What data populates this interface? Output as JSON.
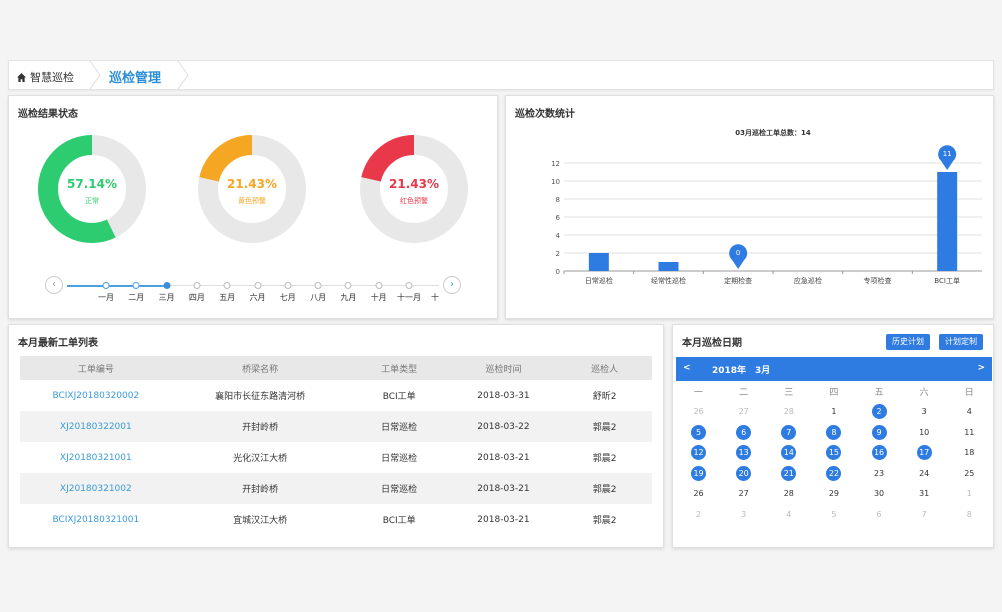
{
  "breadcrumb": {
    "home": "智慧巡检",
    "current": "巡检管理"
  },
  "status_panel": {
    "title": "巡检结果状态",
    "donuts": [
      {
        "percent": "57.14%",
        "label": "正常",
        "value": 0.5714,
        "color": "#2ecc71"
      },
      {
        "percent": "21.43%",
        "label": "黄色预警",
        "value": 0.2143,
        "color": "#f5a623"
      },
      {
        "percent": "21.43%",
        "label": "红色预警",
        "value": 0.2143,
        "color": "#e8384a"
      }
    ],
    "months": [
      "一月",
      "二月",
      "三月",
      "四月",
      "五月",
      "六月",
      "七月",
      "八月",
      "九月",
      "十月",
      "十一月",
      "十"
    ],
    "current_month_index": 2
  },
  "count_panel": {
    "title": "巡检次数统计",
    "chart_data": {
      "type": "bar",
      "title": "03月巡检工单总数：14",
      "categories": [
        "日常巡检",
        "经常性巡检",
        "定期检查",
        "应急巡检",
        "专项检查",
        "BCI工单"
      ],
      "values": [
        2,
        1,
        0,
        0,
        0,
        11
      ],
      "y_ticks": [
        "0",
        "2",
        "4",
        "6",
        "8",
        "10",
        "12"
      ],
      "ylim": [
        0,
        12
      ],
      "pin_labels": [
        {
          "index": 2,
          "text": "0"
        },
        {
          "index": 5,
          "text": "11"
        }
      ],
      "bar_color": "#2e7be2",
      "grid": true
    }
  },
  "workorder_panel": {
    "title": "本月最新工单列表",
    "columns": [
      "工单编号",
      "桥梁名称",
      "工单类型",
      "巡检时间",
      "巡检人"
    ],
    "rows": [
      [
        "BCIXJ20180320002",
        "襄阳市长征东路清河桥",
        "BCI工单",
        "2018-03-31",
        "舒昕2"
      ],
      [
        "XJ20180322001",
        "开封岭桥",
        "日常巡检",
        "2018-03-22",
        "郭晨2"
      ],
      [
        "XJ20180321001",
        "光化汉江大桥",
        "日常巡检",
        "2018-03-21",
        "郭晨2"
      ],
      [
        "XJ20180321002",
        "开封岭桥",
        "日常巡检",
        "2018-03-21",
        "郭晨2"
      ],
      [
        "BCIXJ20180321001",
        "宜城汉江大桥",
        "BCI工单",
        "2018-03-21",
        "郭晨2"
      ]
    ]
  },
  "calendar_panel": {
    "title": "本月巡检日期",
    "history_button": "历史计划",
    "plan_button": "计划定制",
    "year_label": "2018年",
    "month_label": "3月",
    "prev": "<",
    "next": ">",
    "weekdays": [
      "一",
      "二",
      "三",
      "四",
      "五",
      "六",
      "日"
    ],
    "weeks": [
      [
        {
          "d": "26",
          "dim": true
        },
        {
          "d": "27",
          "dim": true
        },
        {
          "d": "28",
          "dim": true
        },
        {
          "d": "1"
        },
        {
          "d": "2",
          "mark": true
        },
        {
          "d": "3"
        },
        {
          "d": "4"
        }
      ],
      [
        {
          "d": "5",
          "mark": true
        },
        {
          "d": "6",
          "mark": true
        },
        {
          "d": "7",
          "mark": true
        },
        {
          "d": "8",
          "mark": true
        },
        {
          "d": "9",
          "mark": true
        },
        {
          "d": "10"
        },
        {
          "d": "11"
        }
      ],
      [
        {
          "d": "12",
          "mark": true
        },
        {
          "d": "13",
          "mark": true
        },
        {
          "d": "14",
          "mark": true
        },
        {
          "d": "15",
          "mark": true
        },
        {
          "d": "16",
          "mark": true
        },
        {
          "d": "17",
          "mark": true
        },
        {
          "d": "18"
        }
      ],
      [
        {
          "d": "19",
          "mark": true
        },
        {
          "d": "20",
          "mark": true
        },
        {
          "d": "21",
          "mark": true
        },
        {
          "d": "22",
          "mark": true
        },
        {
          "d": "23"
        },
        {
          "d": "24"
        },
        {
          "d": "25"
        }
      ],
      [
        {
          "d": "26"
        },
        {
          "d": "27"
        },
        {
          "d": "28"
        },
        {
          "d": "29"
        },
        {
          "d": "30"
        },
        {
          "d": "31"
        },
        {
          "d": "1",
          "dim": true
        }
      ],
      [
        {
          "d": "2",
          "dim": true
        },
        {
          "d": "3",
          "dim": true
        },
        {
          "d": "4",
          "dim": true
        },
        {
          "d": "5",
          "dim": true
        },
        {
          "d": "6",
          "dim": true
        },
        {
          "d": "7",
          "dim": true
        },
        {
          "d": "8",
          "dim": true
        }
      ]
    ]
  }
}
